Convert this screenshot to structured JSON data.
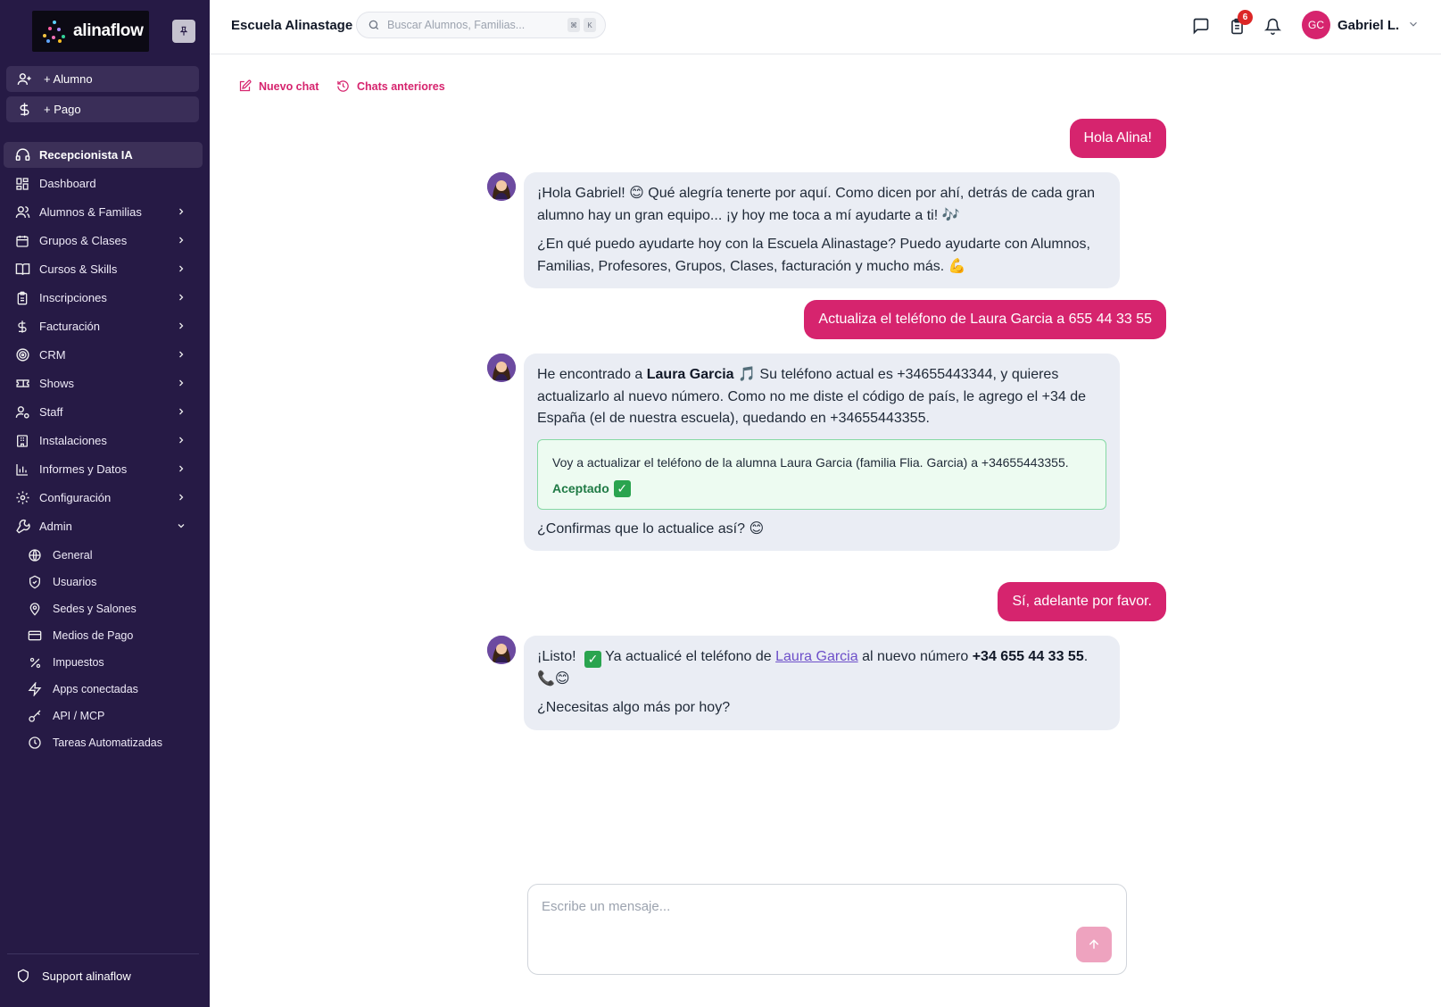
{
  "brand": {
    "name": "alinaflow"
  },
  "quick_actions": [
    {
      "label": "+ Alumno",
      "icon": "user-plus-icon"
    },
    {
      "label": "+ Pago",
      "icon": "dollar-icon"
    }
  ],
  "nav": [
    {
      "label": "Recepcionista IA",
      "icon": "headset-icon",
      "active": true
    },
    {
      "label": "Dashboard",
      "icon": "dashboard-icon"
    },
    {
      "label": "Alumnos & Familias",
      "icon": "users-icon"
    },
    {
      "label": "Grupos & Clases",
      "icon": "calendar-icon"
    },
    {
      "label": "Cursos & Skills",
      "icon": "book-icon"
    },
    {
      "label": "Inscripciones",
      "icon": "clipboard-icon"
    },
    {
      "label": "Facturación",
      "icon": "dollar-icon"
    },
    {
      "label": "CRM",
      "icon": "target-icon"
    },
    {
      "label": "Shows",
      "icon": "ticket-icon"
    },
    {
      "label": "Staff",
      "icon": "user-cog-icon"
    },
    {
      "label": "Instalaciones",
      "icon": "building-icon"
    },
    {
      "label": "Informes y Datos",
      "icon": "bar-chart-icon"
    },
    {
      "label": "Configuración",
      "icon": "gear-icon"
    },
    {
      "label": "Admin",
      "icon": "wrench-icon",
      "expanded": true
    }
  ],
  "admin_items": [
    {
      "label": "General",
      "icon": "globe-icon"
    },
    {
      "label": "Usuarios",
      "icon": "shield-check-icon"
    },
    {
      "label": "Sedes y Salones",
      "icon": "map-pin-icon"
    },
    {
      "label": "Medios de Pago",
      "icon": "credit-card-icon"
    },
    {
      "label": "Impuestos",
      "icon": "percent-icon"
    },
    {
      "label": "Apps conectadas",
      "icon": "zap-icon"
    },
    {
      "label": "API / MCP",
      "icon": "key-icon"
    },
    {
      "label": "Tareas Automatizadas",
      "icon": "clock-icon"
    }
  ],
  "support": {
    "label": "Support alinaflow"
  },
  "header": {
    "school": "Escuela Alinastage",
    "search_placeholder": "Buscar Alumnos, Familias...",
    "kbd": [
      "⌘",
      "K"
    ],
    "tasks_badge": "6",
    "user_initials": "GC",
    "user_name": "Gabriel L."
  },
  "chat_toolbar": {
    "new_chat": "Nuevo chat",
    "history": "Chats anteriores"
  },
  "messages": {
    "u1": "Hola Alina!",
    "b1_p1": "¡Hola Gabriel! 😊 Qué alegría tenerte por aquí. Como dicen por ahí, detrás de cada gran alumno hay un gran equipo... ¡y hoy me toca a mí ayudarte a ti! 🎶",
    "b1_p2": "¿En qué puedo ayudarte hoy con la Escuela Alinastage? Puedo ayudarte con Alumnos, Familias, Profesores, Grupos, Clases, facturación y mucho más. 💪",
    "u2": "Actualiza el teléfono de Laura Garcia a 655 44 33 55",
    "b2_pre": "He encontrado a ",
    "b2_name": "Laura Garcia",
    "b2_post": " 🎵 Su teléfono actual es +34655443344, y quieres actualizarlo al nuevo número. Como no me diste el código de país, le agrego el +34 de España (el de nuestra escuela), quedando en +34655443355.",
    "b2_box": "Voy a actualizar el teléfono de la alumna Laura Garcia (familia Flia. Garcia) a +34655443355.",
    "b2_accepted": "Aceptado",
    "b2_question": "¿Confirmas que lo actualice así? 😊",
    "u3": "Sí, adelante por favor.",
    "b3_pre": "¡Listo! ",
    "b3_mid": " Ya actualicé el teléfono de ",
    "b3_link": "Laura Garcia",
    "b3_mid2": " al nuevo número ",
    "b3_number": "+34 655 44 33 55",
    "b3_end": ". 📞😊",
    "b3_p2": "¿Necesitas algo más por hoy?"
  },
  "composer": {
    "placeholder": "Escribe un mensaje..."
  },
  "colors": {
    "sidebar": "#261a45",
    "accent": "#d6246e",
    "bot_bubble": "#eaedf4",
    "success": "#1f7a45"
  }
}
